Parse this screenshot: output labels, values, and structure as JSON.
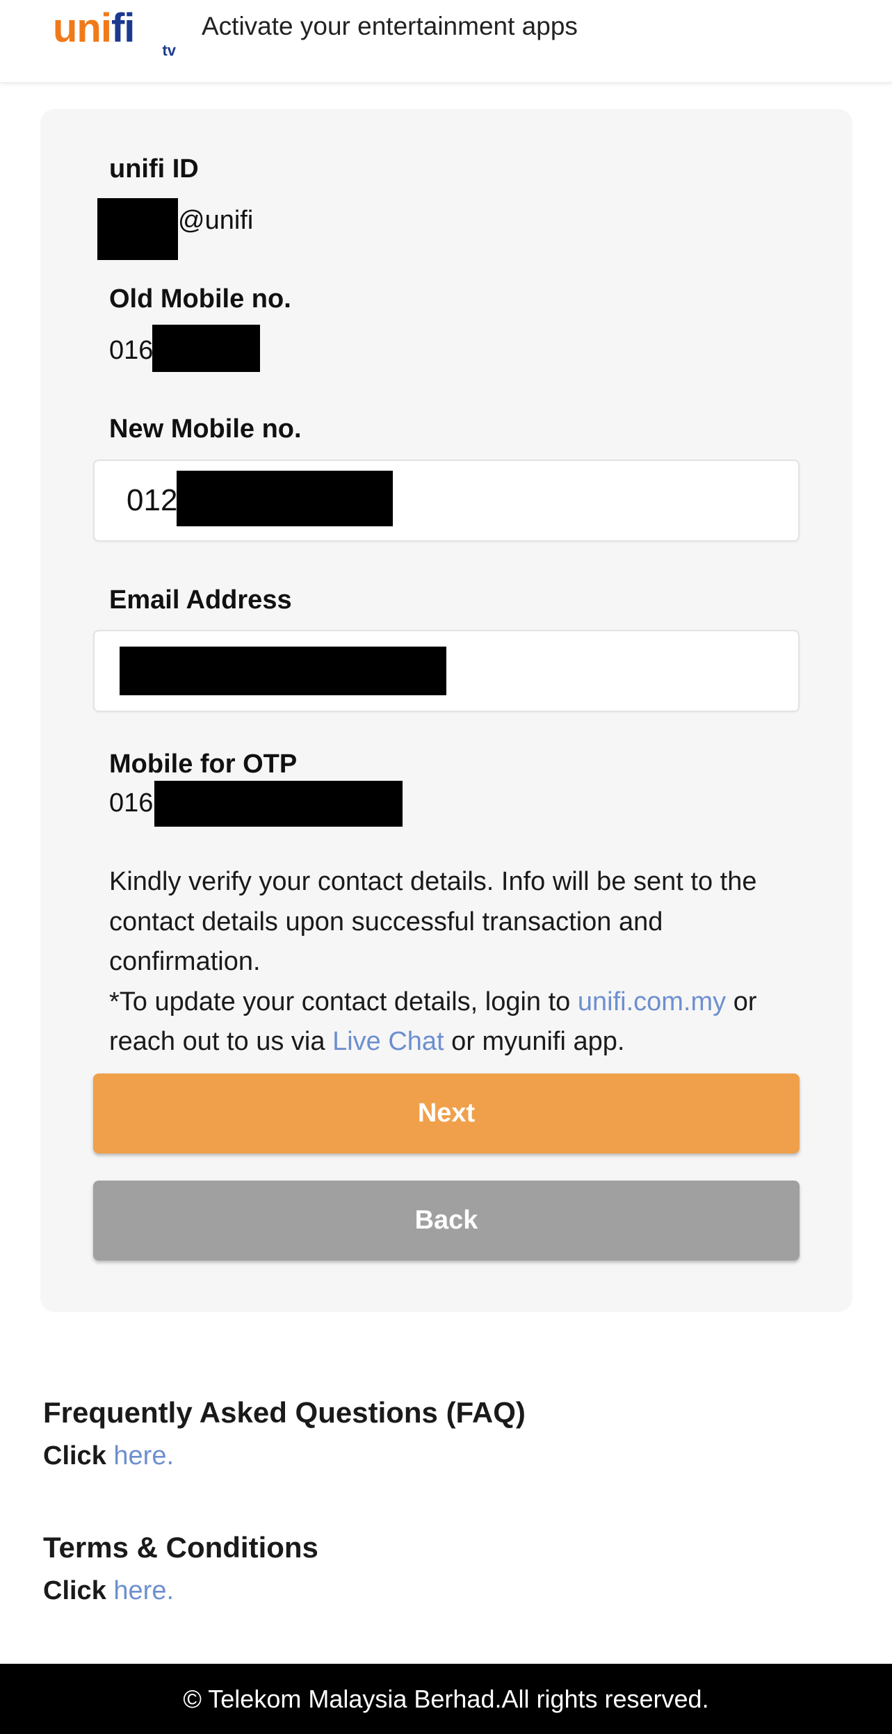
{
  "header": {
    "logo_main": "unifi",
    "logo_sub": "tv",
    "title": "Activate your entertainment apps"
  },
  "form": {
    "unifi_id_label": "unifi ID",
    "unifi_id_suffix": "@unifi",
    "old_mobile_label": "Old Mobile no.",
    "old_mobile_prefix": "016",
    "new_mobile_label": "New Mobile no.",
    "new_mobile_prefix": "012",
    "email_label": "Email Address",
    "otp_mobile_label": "Mobile for OTP",
    "otp_mobile_prefix": "016"
  },
  "notice": {
    "line1": "Kindly verify your contact details. Info will be sent to the contact details upon successful transaction and confirmation.",
    "update_prefix": "*To update your contact details, login to ",
    "site_link": "unifi.com.my",
    "update_mid": " or reach out to us via ",
    "chat_link": "Live Chat",
    "update_suffix": " or myunifi app."
  },
  "buttons": {
    "next": "Next",
    "back": "Back"
  },
  "faq": {
    "title": "Frequently Asked Questions (FAQ)",
    "click": "Click",
    "link": "here."
  },
  "terms": {
    "title": "Terms & Conditions",
    "click": "Click",
    "link": "here."
  },
  "footer": {
    "copyright": "© Telekom Malaysia Berhad.All rights reserved."
  },
  "colors": {
    "accent_orange": "#f0a04b",
    "back_gray": "#a0a0a0",
    "link_blue": "#6d8fcf"
  }
}
